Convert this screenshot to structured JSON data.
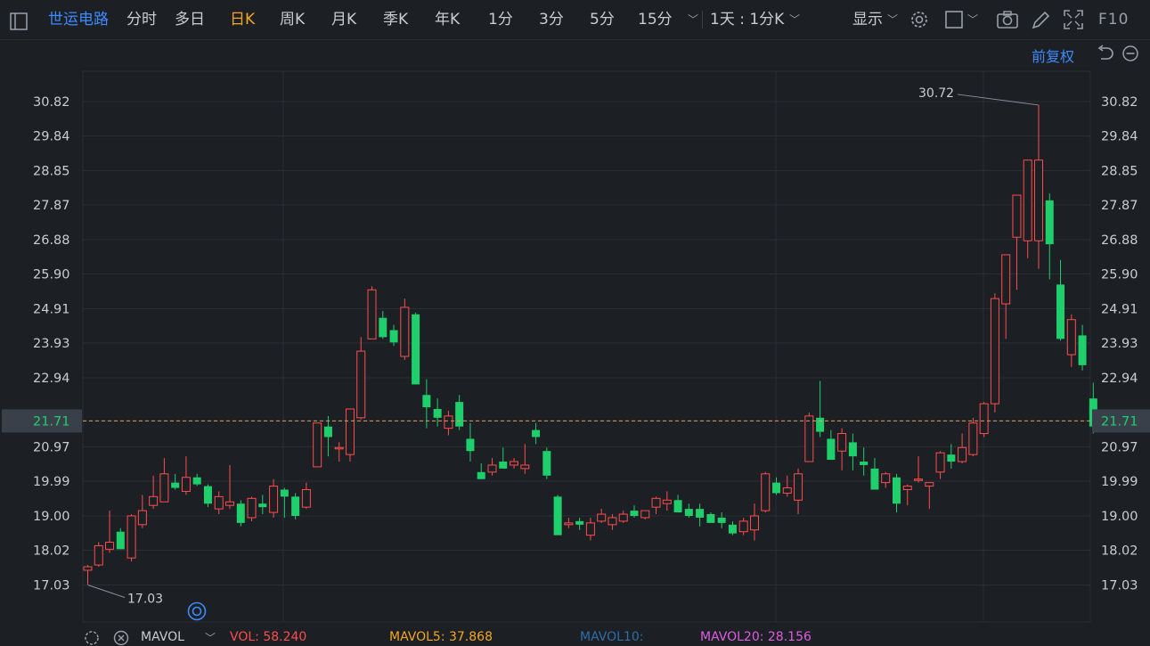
{
  "toolbar": {
    "stock_name": "世运电路",
    "periods": [
      "分时",
      "多日",
      "日K",
      "周K",
      "月K",
      "季K",
      "年K",
      "1分",
      "3分",
      "5分",
      "15分"
    ],
    "active_period": "日K",
    "interval": "1天 : 1分K",
    "display_label": "显示",
    "f10_label": "F10"
  },
  "price_adjust": "前复权",
  "chart_data": {
    "type": "candlestick",
    "y_ticks": [
      30.82,
      29.84,
      28.85,
      27.87,
      26.88,
      25.9,
      24.91,
      23.93,
      22.94,
      21.71,
      20.97,
      19.99,
      19.0,
      18.02,
      17.03
    ],
    "ylim": [
      16.1,
      31.6
    ],
    "current_price": "21.71",
    "high_label": "30.72",
    "low_label": "17.03",
    "up_color": "#ff4d4d",
    "down_color": "#1fcf6b",
    "candles": [
      [
        17.45,
        17.6,
        17.05,
        17.55
      ],
      [
        17.6,
        18.25,
        17.55,
        18.15
      ],
      [
        18.05,
        19.15,
        17.95,
        18.25
      ],
      [
        18.55,
        18.65,
        18.05,
        18.05
      ],
      [
        17.8,
        19.05,
        17.7,
        19.0
      ],
      [
        18.75,
        19.6,
        18.65,
        19.15
      ],
      [
        19.3,
        20.15,
        19.2,
        19.55
      ],
      [
        19.4,
        20.65,
        19.4,
        20.2
      ],
      [
        19.95,
        20.2,
        19.75,
        19.8
      ],
      [
        19.7,
        20.7,
        19.6,
        20.1
      ],
      [
        20.1,
        20.2,
        19.85,
        19.9
      ],
      [
        19.85,
        19.9,
        19.25,
        19.35
      ],
      [
        19.2,
        19.7,
        19.05,
        19.55
      ],
      [
        19.3,
        20.45,
        19.2,
        19.4
      ],
      [
        19.35,
        19.45,
        18.7,
        18.8
      ],
      [
        18.95,
        19.55,
        18.85,
        19.5
      ],
      [
        19.35,
        19.6,
        19.05,
        19.25
      ],
      [
        19.1,
        20.05,
        18.95,
        19.85
      ],
      [
        19.75,
        19.8,
        18.95,
        19.55
      ],
      [
        19.55,
        19.65,
        18.9,
        19.0
      ],
      [
        19.25,
        19.95,
        19.2,
        19.75
      ],
      [
        20.4,
        21.65,
        20.4,
        21.65
      ],
      [
        21.55,
        21.85,
        20.7,
        21.25
      ],
      [
        20.95,
        21.1,
        20.55,
        20.95
      ],
      [
        20.75,
        22.05,
        20.55,
        22.05
      ],
      [
        21.8,
        24.1,
        21.75,
        23.7
      ],
      [
        24.05,
        25.55,
        24.05,
        25.45
      ],
      [
        24.65,
        24.85,
        24.05,
        24.1
      ],
      [
        24.3,
        24.45,
        23.85,
        23.95
      ],
      [
        23.55,
        25.2,
        23.45,
        24.95
      ],
      [
        24.75,
        24.8,
        22.75,
        22.75
      ],
      [
        22.45,
        22.9,
        21.5,
        22.1
      ],
      [
        22.05,
        22.35,
        21.55,
        21.8
      ],
      [
        21.5,
        22.0,
        21.3,
        21.85
      ],
      [
        22.25,
        22.45,
        21.45,
        21.55
      ],
      [
        21.2,
        21.65,
        20.55,
        20.85
      ],
      [
        20.25,
        20.5,
        20.05,
        20.05
      ],
      [
        20.25,
        20.65,
        20.15,
        20.45
      ],
      [
        20.55,
        20.95,
        20.55,
        20.35
      ],
      [
        20.45,
        20.65,
        20.35,
        20.55
      ],
      [
        20.35,
        21.05,
        20.2,
        20.45
      ],
      [
        21.45,
        21.65,
        21.05,
        21.25
      ],
      [
        20.85,
        20.95,
        20.05,
        20.15
      ],
      [
        19.55,
        19.6,
        18.5,
        18.45
      ],
      [
        18.75,
        18.95,
        18.65,
        18.8
      ],
      [
        18.85,
        18.95,
        18.6,
        18.75
      ],
      [
        18.45,
        18.95,
        18.3,
        18.8
      ],
      [
        18.85,
        19.2,
        18.8,
        19.05
      ],
      [
        18.75,
        19.05,
        18.6,
        18.95
      ],
      [
        18.85,
        19.15,
        18.8,
        19.05
      ],
      [
        19.15,
        19.3,
        18.95,
        19.0
      ],
      [
        18.95,
        19.15,
        18.9,
        19.15
      ],
      [
        19.25,
        19.55,
        19.05,
        19.5
      ],
      [
        19.35,
        19.7,
        19.15,
        19.45
      ],
      [
        19.45,
        19.6,
        19.1,
        19.1
      ],
      [
        19.2,
        19.35,
        18.95,
        19.0
      ],
      [
        19.2,
        19.35,
        18.7,
        18.95
      ],
      [
        19.05,
        19.1,
        18.85,
        18.8
      ],
      [
        18.95,
        19.1,
        18.65,
        18.8
      ],
      [
        18.75,
        18.85,
        18.45,
        18.5
      ],
      [
        18.55,
        18.95,
        18.45,
        18.85
      ],
      [
        18.6,
        19.35,
        18.3,
        19.0
      ],
      [
        19.15,
        20.25,
        19.1,
        20.2
      ],
      [
        19.95,
        20.1,
        19.6,
        19.65
      ],
      [
        19.65,
        20.15,
        19.55,
        19.8
      ],
      [
        19.45,
        20.35,
        19.05,
        20.2
      ],
      [
        20.55,
        21.95,
        20.55,
        21.85
      ],
      [
        21.8,
        22.85,
        21.25,
        21.4
      ],
      [
        21.2,
        21.45,
        20.65,
        20.6
      ],
      [
        20.85,
        21.5,
        20.3,
        21.35
      ],
      [
        21.1,
        21.35,
        20.3,
        20.7
      ],
      [
        20.55,
        20.95,
        20.15,
        20.45
      ],
      [
        20.35,
        20.65,
        19.95,
        19.75
      ],
      [
        19.95,
        20.25,
        19.8,
        20.2
      ],
      [
        20.1,
        20.2,
        19.1,
        19.35
      ],
      [
        19.75,
        19.9,
        19.3,
        19.85
      ],
      [
        20.05,
        20.7,
        19.95,
        20.05
      ],
      [
        19.85,
        19.9,
        19.2,
        19.95
      ],
      [
        20.25,
        20.85,
        20.05,
        20.8
      ],
      [
        20.75,
        21.05,
        20.35,
        20.55
      ],
      [
        20.55,
        21.35,
        20.5,
        20.95
      ],
      [
        20.75,
        21.8,
        20.7,
        21.65
      ],
      [
        21.35,
        22.25,
        21.25,
        22.2
      ],
      [
        22.2,
        25.35,
        21.95,
        25.2
      ],
      [
        25.05,
        26.1,
        24.05,
        26.45
      ],
      [
        26.95,
        28.05,
        25.45,
        28.15
      ],
      [
        26.85,
        29.15,
        26.35,
        29.15
      ],
      [
        26.85,
        30.72,
        26.05,
        29.15
      ],
      [
        28.0,
        28.2,
        25.75,
        26.75
      ],
      [
        25.6,
        26.3,
        24.0,
        24.05
      ],
      [
        23.6,
        24.75,
        23.25,
        24.6
      ],
      [
        24.15,
        24.45,
        23.15,
        23.3
      ],
      [
        22.35,
        22.8,
        21.35,
        21.55
      ]
    ],
    "volume": {
      "mavol_label": "MAVOL",
      "vol": "VOL: 58.240",
      "mavol5": "MAVOL5: 37.868",
      "mavol10": "MAVOL10:",
      "mavol20": "MAVOL20: 28.156"
    }
  }
}
